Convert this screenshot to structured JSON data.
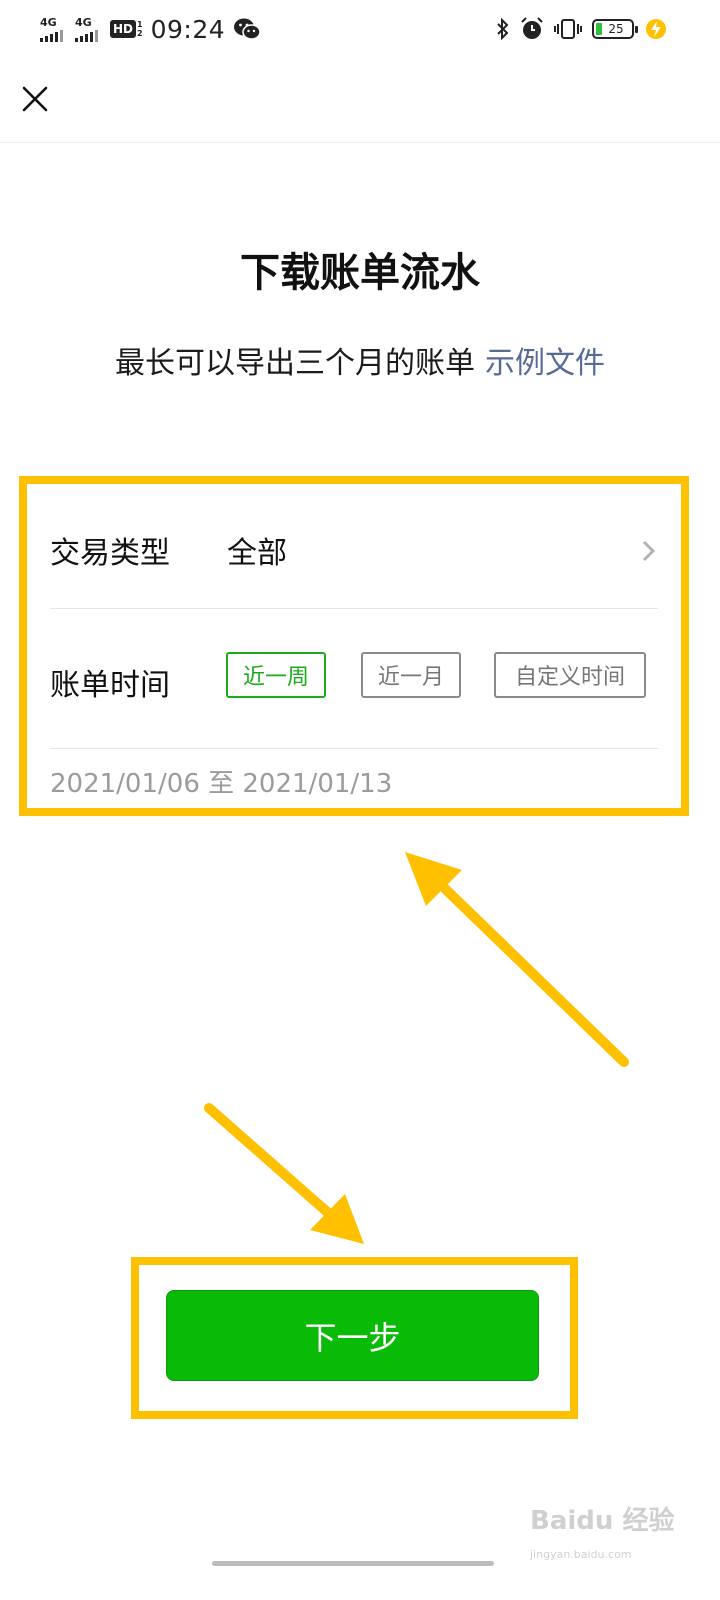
{
  "status_bar": {
    "signal1": "4G",
    "signal2": "4G",
    "hd": "HD",
    "hd_fraction_top": "1",
    "hd_fraction_bottom": "2",
    "time": "09:24",
    "battery": "25",
    "battery_color": "#2fbf3a"
  },
  "page": {
    "title": "下载账单流水",
    "subtitle": "最长可以导出三个月的账单",
    "example_link": "示例文件"
  },
  "form": {
    "type_label": "交易类型",
    "type_value": "全部",
    "time_label": "账单时间",
    "options": [
      {
        "label": "近一周",
        "selected": true
      },
      {
        "label": "近一月",
        "selected": false
      },
      {
        "label": "自定义时间",
        "selected": false
      }
    ],
    "date_range": "2021/01/06 至 2021/01/13"
  },
  "actions": {
    "next": "下一步"
  },
  "watermark": {
    "brand": "Baidu 经验",
    "url": "jingyan.baidu.com"
  },
  "colors": {
    "accent_green": "#09bb07",
    "selected_green": "#1aad19",
    "link_blue": "#576b95",
    "highlight_yellow": "#ffc000"
  }
}
